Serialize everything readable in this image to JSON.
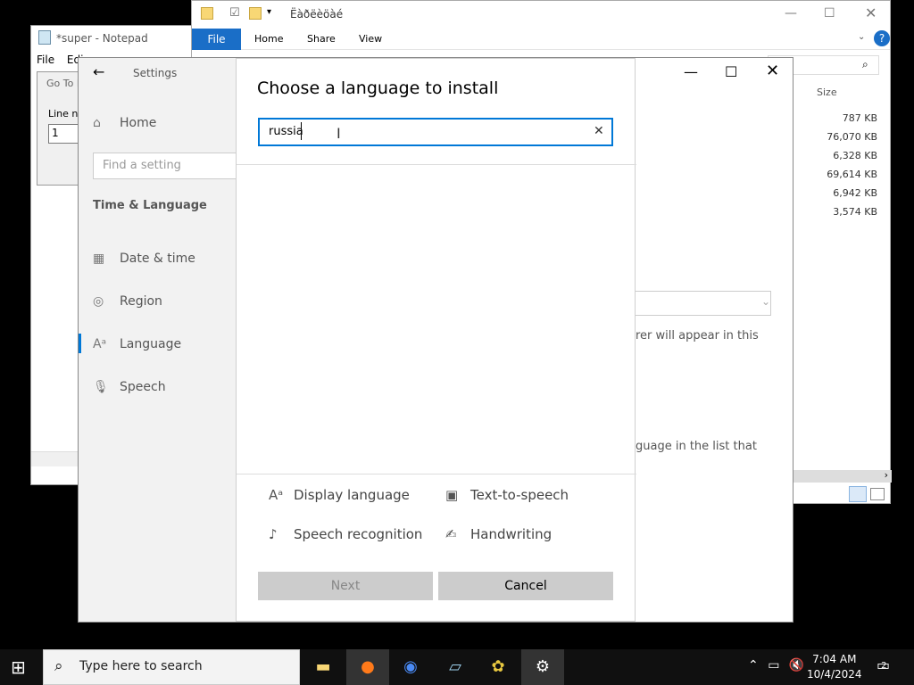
{
  "notepad": {
    "title": "*super - Notepad",
    "menu": [
      "File",
      "Edi"
    ],
    "goto_title": "Go To L",
    "goto_label": "Line nu",
    "goto_value": "1"
  },
  "explorer": {
    "title": "Ëàðëèöàé",
    "tabs": [
      "File",
      "Home",
      "Share",
      "View"
    ],
    "size_header": "Size",
    "sizes": [
      "787 KB",
      "76,070 KB",
      "6,328 KB",
      "69,614 KB",
      "6,942 KB",
      "3,574 KB"
    ]
  },
  "settings": {
    "title": "Settings",
    "home": "Home",
    "find_placeholder": "Find a setting",
    "group": "Time & Language",
    "nav": [
      "Date & time",
      "Region",
      "Language",
      "Speech"
    ],
    "bg_text_1": "rer will appear in this",
    "bg_text_2": "guage in the list that"
  },
  "dialog": {
    "title": "Choose a language to install",
    "search_value": "russia",
    "features": {
      "display": "Display language",
      "tts": "Text-to-speech",
      "speech": "Speech recognition",
      "handwriting": "Handwriting"
    },
    "next_label": "Next",
    "cancel_label": "Cancel"
  },
  "taskbar": {
    "search_placeholder": "Type here to search",
    "time": "7:04 AM",
    "date": "10/4/2024",
    "notif_count": "2"
  },
  "colors": {
    "accent": "#0078d7",
    "explorer_file_tab": "#1a6ec7"
  }
}
